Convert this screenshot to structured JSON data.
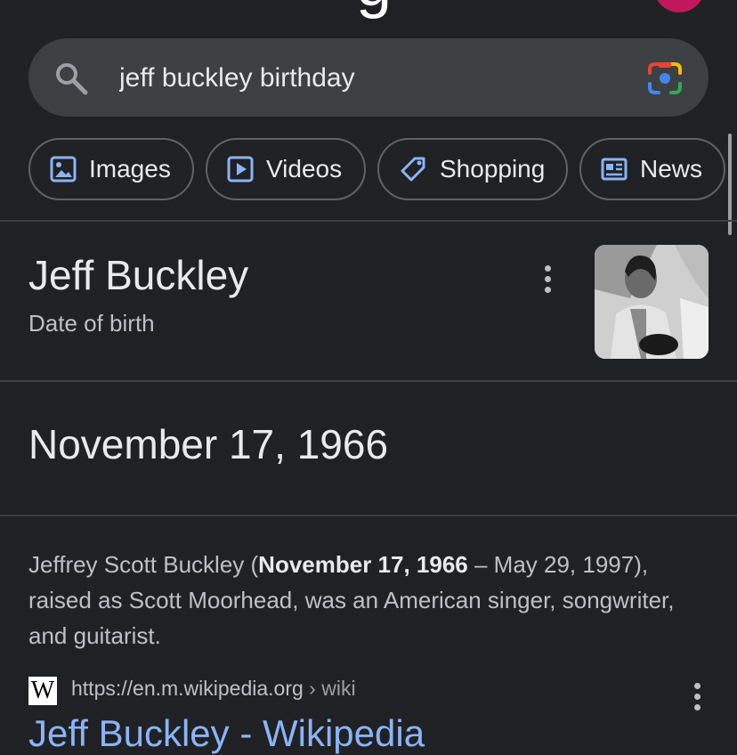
{
  "header": {
    "logo_char": "g",
    "top_dot_char": "·"
  },
  "search": {
    "query": "jeff buckley birthday",
    "icon": "search-icon",
    "lens_icon": "google-lens-icon"
  },
  "chips": [
    {
      "label": "Images",
      "icon": "image-icon"
    },
    {
      "label": "Videos",
      "icon": "video-icon"
    },
    {
      "label": "Shopping",
      "icon": "tag-icon"
    },
    {
      "label": "News",
      "icon": "news-icon"
    }
  ],
  "knowledge_panel": {
    "title": "Jeff Buckley",
    "subtitle": "Date of birth",
    "answer": "November 17, 1966"
  },
  "snippet": {
    "part1": "Jeffrey Scott Buckley (",
    "bold": "November 17, 1966",
    "part2": " – May 29, 1997), raised as Scott Moorhead, was an American singer, songwriter, and guitarist."
  },
  "result": {
    "favicon_text": "W",
    "url": "https://en.m.wikipedia.org",
    "breadcrumb": " › wiki",
    "title": "Jeff Buckley - Wikipedia"
  },
  "colors": {
    "background": "#202124",
    "link": "#8ab4f8",
    "avatar": "#c2185b"
  }
}
